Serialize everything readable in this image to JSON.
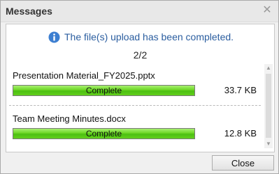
{
  "dialog": {
    "title": "Messages",
    "close_button_label": "Close"
  },
  "notice": {
    "text": "The file(s) upload has been completed.",
    "icon": "info-icon"
  },
  "counter": "2/2",
  "files": [
    {
      "name": "Presentation Material_FY2025.pptx",
      "status": "Complete",
      "size": "33.7 KB",
      "progress": 1.0
    },
    {
      "name": "Team Meeting Minutes.docx",
      "status": "Complete",
      "size": "12.8 KB",
      "progress": 1.0
    }
  ],
  "colors": {
    "notice_text": "#2a5d9f",
    "progress_green": "#5ccc1a"
  }
}
